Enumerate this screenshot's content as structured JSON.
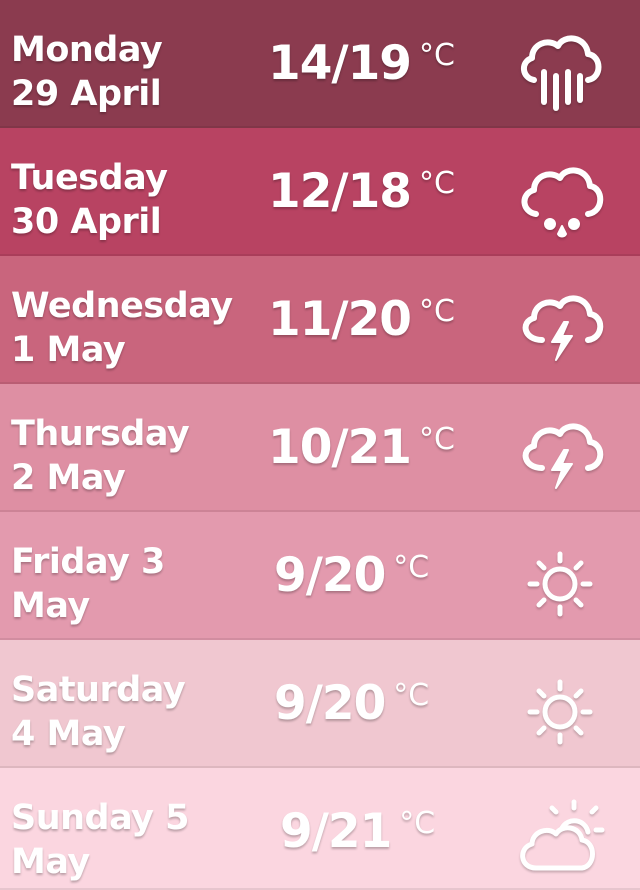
{
  "colors": {
    "row0": "#8b3b4f",
    "row1": "#b84362",
    "row2": "#c9657d",
    "row3": "#de8fa3",
    "row4": "#e39aae",
    "row5": "#f0c7d0",
    "row6": "#fbd6e0"
  },
  "forecast": [
    {
      "day": "Monday",
      "date": "29 April",
      "temp": "14/19",
      "unit": "°C",
      "icon": "heavy-rain-icon"
    },
    {
      "day": "Tuesday",
      "date": "30 April",
      "temp": "12/18",
      "unit": "°C",
      "icon": "light-rain-icon"
    },
    {
      "day": "Wednesday",
      "date": "1 May",
      "temp": "11/20",
      "unit": "°C",
      "icon": "thunderstorm-icon"
    },
    {
      "day": "Thursday",
      "date": "2 May",
      "temp": "10/21",
      "unit": "°C",
      "icon": "thunderstorm-icon"
    },
    {
      "day": "Friday 3",
      "date": "May",
      "temp": "9/20",
      "unit": "°C",
      "icon": "sun-icon"
    },
    {
      "day": "Saturday",
      "date": "4 May",
      "temp": "9/20",
      "unit": "°C",
      "icon": "sun-icon"
    },
    {
      "day": "Sunday 5",
      "date": "May",
      "temp": "9/21",
      "unit": "°C",
      "icon": "partly-cloudy-icon"
    }
  ]
}
